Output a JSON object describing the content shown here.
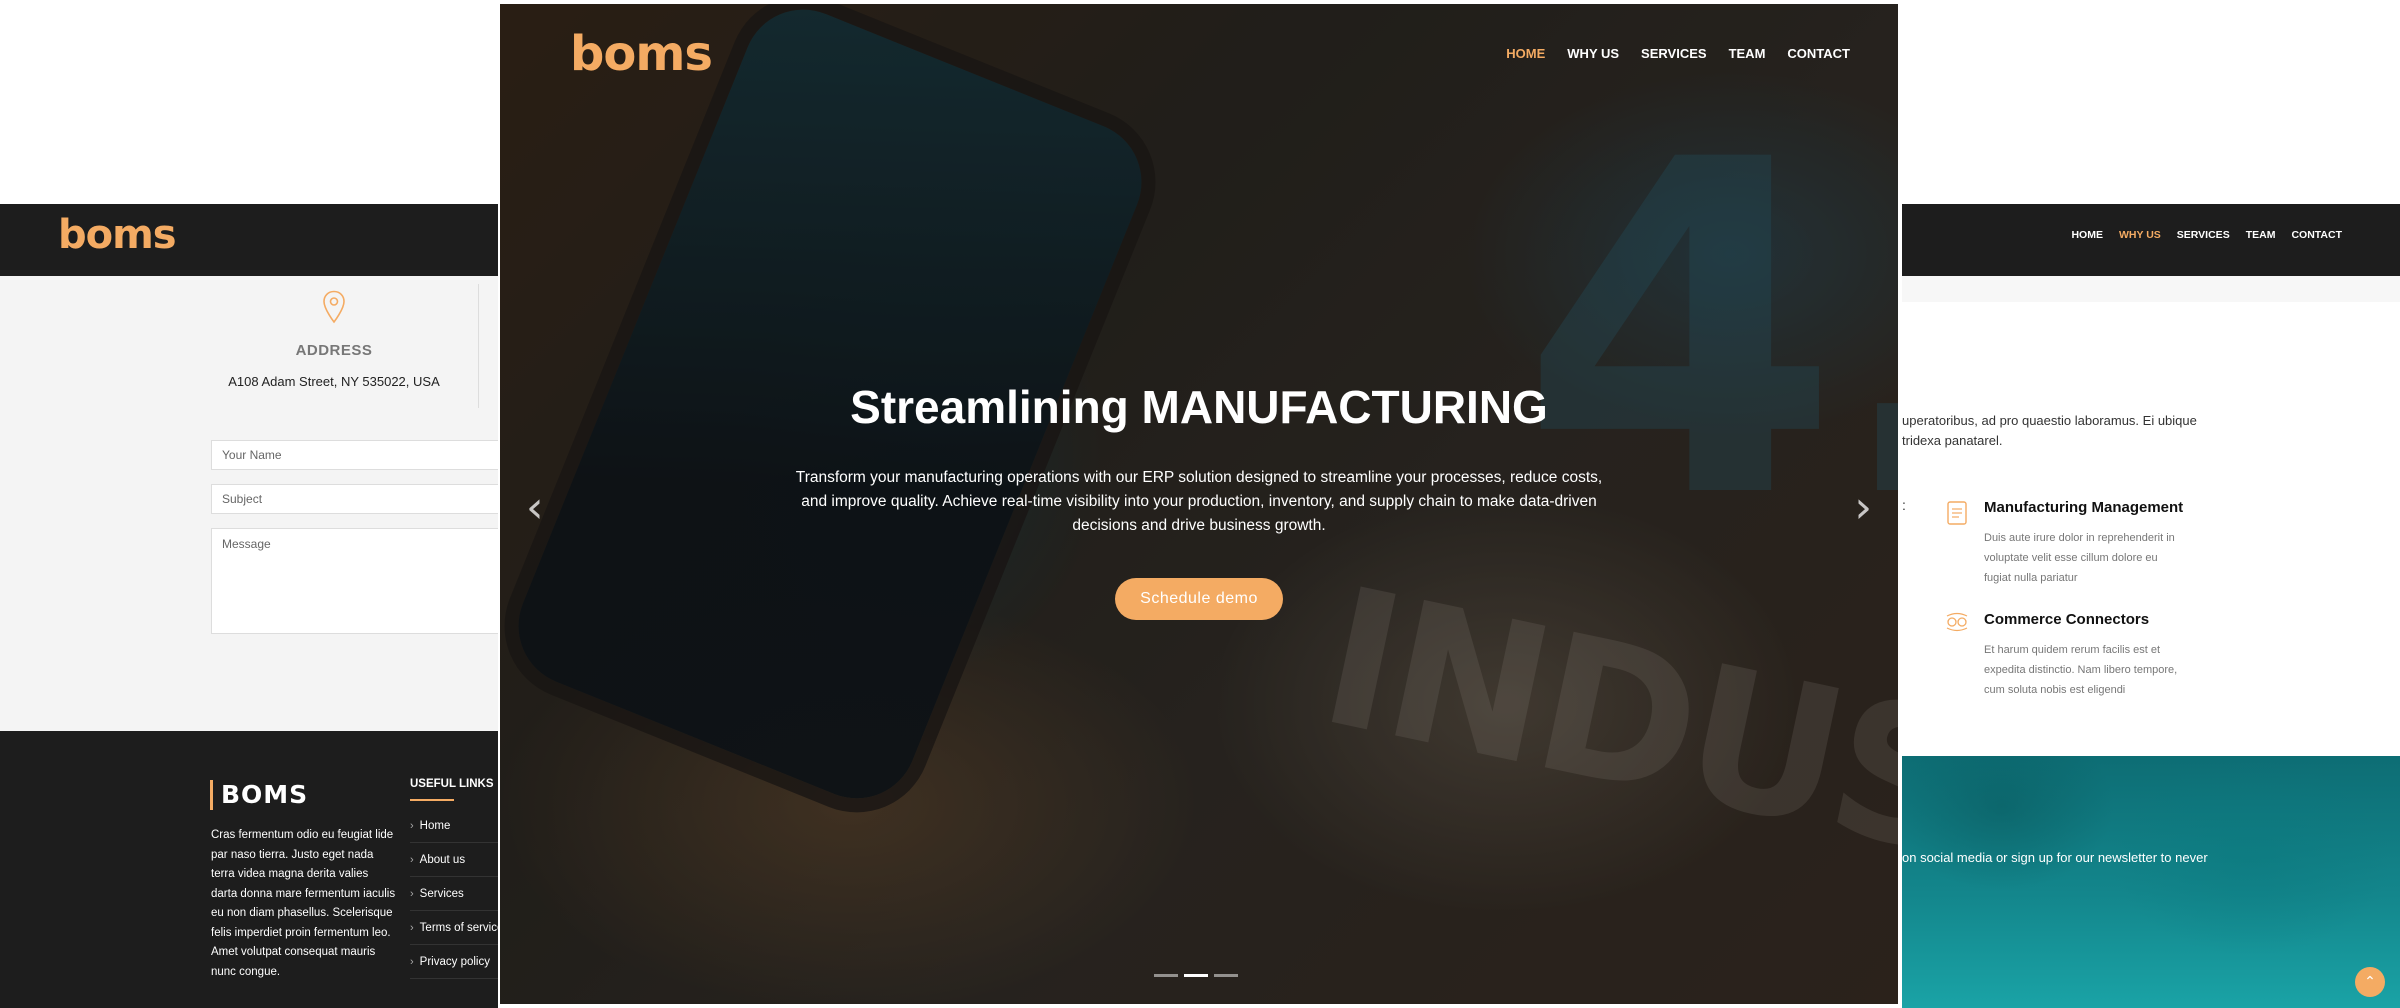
{
  "brand": {
    "logo": "boms",
    "footer_name": "BOMS",
    "accent": "#f4ab63"
  },
  "nav": {
    "items": [
      "HOME",
      "WHY US",
      "SERVICES",
      "TEAM",
      "CONTACT"
    ],
    "hero_active": "HOME",
    "right_active": "WHY US"
  },
  "hero": {
    "title": "Streamlining MANUFACTURING",
    "text": "Transform your manufacturing operations with our ERP solution designed to streamline your processes, reduce costs, and improve quality. Achieve real-time visibility into your production, inventory, and supply chain to make data-driven decisions and drive business growth.",
    "cta": "Schedule demo",
    "prev_icon": "chevron-left-icon",
    "next_icon": "chevron-right-icon",
    "slides": 3,
    "active_slide": 2
  },
  "contact": {
    "address_icon": "map-pin-icon",
    "address_title": "ADDRESS",
    "address_value": "A108 Adam Street, NY 535022, USA",
    "placeholders": {
      "name": "Your Name",
      "subject": "Subject",
      "message": "Message"
    }
  },
  "footer": {
    "about_text": "Cras fermentum odio eu feugiat lide par naso tierra. Justo eget nada terra videa magna derita valies darta donna mare fermentum iaculis eu non diam phasellus. Scelerisque felis imperdiet proin fermentum leo. Amet volutpat consequat mauris nunc congue.",
    "links_title": "USEFUL LINKS",
    "links": [
      "Home",
      "About us",
      "Services",
      "Terms of service",
      "Privacy policy"
    ]
  },
  "why_us": {
    "intro": "uperatoribus, ad pro quaestio laboramus. Ei ubique tridexa panatarel.",
    "colon": ":",
    "services": [
      {
        "icon": "document-icon",
        "title": "Manufacturing Management",
        "desc": "Duis aute irure dolor in reprehenderit in voluptate velit esse cillum dolore eu fugiat nulla pariatur"
      },
      {
        "icon": "connectors-icon",
        "title": "Commerce Connectors",
        "desc": "Et harum quidem rerum facilis est et expedita distinctio. Nam libero tempore, cum soluta nobis est eligendi"
      }
    ]
  },
  "newsletter": {
    "text": "on social media or sign up for our newsletter to never"
  },
  "back_to_top": {
    "icon": "arrow-up-icon",
    "glyph": "⌃"
  }
}
